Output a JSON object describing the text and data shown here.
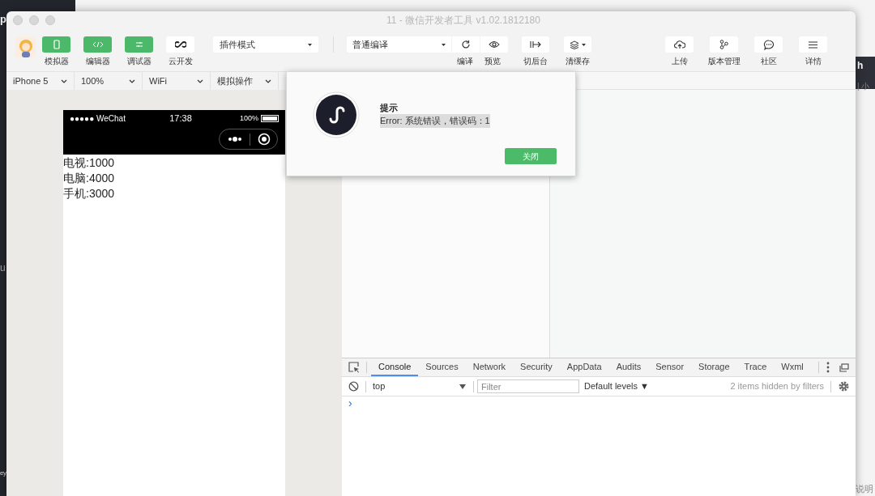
{
  "window": {
    "title": "11 - 微信开发者工具 v1.02.1812180"
  },
  "toolbar_left": [
    {
      "label": "模拟器",
      "on": true
    },
    {
      "label": "编辑器",
      "on": true
    },
    {
      "label": "调试器",
      "on": true
    },
    {
      "label": "云开发",
      "on": false
    }
  ],
  "mode_select": "插件模式",
  "compile_select": "普通编译",
  "compile_actions": [
    "编译",
    "预览"
  ],
  "background_action": "切后台",
  "cache_action": "清缓存",
  "toolbar_right": [
    "上传",
    "版本管理",
    "社区",
    "详情"
  ],
  "device_bar": [
    "iPhone 5",
    "100%",
    "WiFi",
    "模拟操作"
  ],
  "phone": {
    "carrier": "●●●●● WeChat",
    "time": "17:38",
    "battery": "100%",
    "lines": [
      "电视:1000",
      "电脑:4000",
      "手机:3000"
    ]
  },
  "dialog": {
    "title": "提示",
    "message": "Error: 系统错误，错误码：1",
    "button": "关闭"
  },
  "devtools": {
    "tabs": [
      {
        "label": "Console",
        "selected": true
      },
      {
        "label": "Sources",
        "selected": false
      },
      {
        "label": "Network",
        "selected": false
      },
      {
        "label": "Security",
        "selected": false
      },
      {
        "label": "AppData",
        "selected": false
      },
      {
        "label": "Audits",
        "selected": false
      },
      {
        "label": "Sensor",
        "selected": false
      },
      {
        "label": "Storage",
        "selected": false
      },
      {
        "label": "Trace",
        "selected": false
      },
      {
        "label": "Wxml",
        "selected": false
      }
    ],
    "context": "top",
    "filter_placeholder": "Filter",
    "levels": "Default levels ▼",
    "hidden_note": "2 items hidden by filters",
    "prompt": "›"
  },
  "background_fragments": [
    "p",
    "u",
    "ey",
    "h",
    "| 小",
    "说明"
  ]
}
